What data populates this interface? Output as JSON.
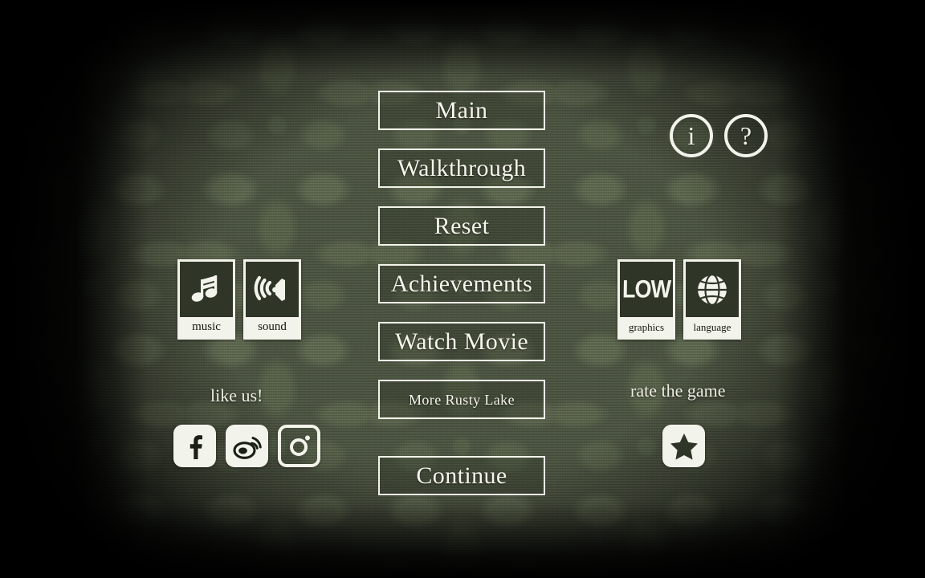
{
  "theme": {
    "background_color": "#4d5642",
    "ink_color": "#f2f3ea",
    "dark_color": "#2f3628",
    "vignette_color": "#000000"
  },
  "menu": {
    "buttons": [
      {
        "label": "Main",
        "size": "large",
        "name": "main"
      },
      {
        "label": "Walkthrough",
        "size": "large",
        "name": "walkthrough"
      },
      {
        "label": "Reset",
        "size": "large",
        "name": "reset"
      },
      {
        "label": "Achievements",
        "size": "large",
        "name": "achievements"
      },
      {
        "label": "Watch Movie",
        "size": "large",
        "name": "watch-movie"
      },
      {
        "label": "More Rusty Lake",
        "size": "small",
        "name": "more-rusty-lake"
      },
      {
        "label": "Continue",
        "size": "large",
        "name": "continue"
      }
    ]
  },
  "top_right": {
    "info_label": "i",
    "help_label": "?"
  },
  "audio_settings": {
    "cards": [
      {
        "label": "music",
        "icon": "music-note-icon",
        "name": "music"
      },
      {
        "label": "sound",
        "icon": "speaker-waves-icon",
        "name": "sound"
      }
    ]
  },
  "display_settings": {
    "cards": [
      {
        "label": "graphics",
        "icon": "low-text-icon",
        "value": "LOW",
        "name": "graphics"
      },
      {
        "label": "language",
        "icon": "globe-icon",
        "name": "language"
      }
    ]
  },
  "social": {
    "caption": "like us!",
    "icons": [
      {
        "name": "facebook-icon",
        "title": "Facebook"
      },
      {
        "name": "weibo-icon",
        "title": "Weibo"
      },
      {
        "name": "instagram-icon",
        "title": "Instagram"
      }
    ]
  },
  "rate": {
    "caption": "rate the game",
    "icon": "star-icon"
  }
}
